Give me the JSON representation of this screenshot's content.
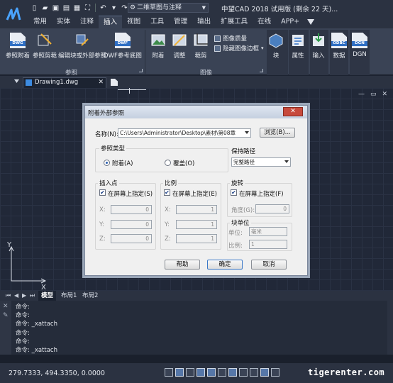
{
  "title_bar": {
    "workspace": "二维草图与注释",
    "app_title": "中望CAD 2018 试用版 (剩余 22 天)..."
  },
  "menu": {
    "tabs": [
      "常用",
      "实体",
      "注释",
      "插入",
      "视图",
      "工具",
      "管理",
      "输出",
      "扩展工具",
      "在线",
      "APP+"
    ],
    "active": "插入"
  },
  "ribbon": {
    "reference_panel": {
      "title": "参照",
      "buttons": [
        {
          "label": "参照附着",
          "badge": "DWG"
        },
        {
          "label": "参照剪裁",
          "badge": ""
        },
        {
          "label": "编辑块或外部参照",
          "badge": ""
        },
        {
          "label": "DWF参考底图",
          "badge": "DWF"
        }
      ]
    },
    "image_panel": {
      "title": "图像",
      "buttons": [
        "附着",
        "调整",
        "裁剪"
      ],
      "small_buttons": [
        "图像质量",
        "隐藏图像边框"
      ]
    },
    "right_buttons": [
      {
        "label": "块",
        "badge": ""
      },
      {
        "label": "属性",
        "badge": ""
      },
      {
        "label": "输入",
        "badge": ""
      },
      {
        "label": "数据",
        "badge": "ODBC"
      },
      {
        "label": "DGN",
        "badge": "DGN"
      }
    ]
  },
  "doc_tab": {
    "name": "Drawing1.dwg",
    "close": "✕"
  },
  "canvas": {
    "ucs_y": "Y",
    "ucs_x": "X",
    "win_min": "—",
    "win_max": "▭",
    "win_close": "✕"
  },
  "dialog": {
    "title": "附着外部参照",
    "close": "✕",
    "name_label": "名称(N):",
    "name_value": "C:\\Users\\Administrator\\Desktop\\素材\\第08章",
    "browse_label": "浏览(B)...",
    "ref_type": {
      "title": "参照类型",
      "options": [
        "附着(A)",
        "覆盖(O)"
      ],
      "selected": "附着(A)"
    },
    "path_type": {
      "title": "保持路径",
      "value": "完整路径"
    },
    "insert_point": {
      "title": "插入点",
      "on_screen": "在屏幕上指定(S)",
      "fields": [
        {
          "label": "X:",
          "value": "0"
        },
        {
          "label": "Y:",
          "value": "0"
        },
        {
          "label": "Z:",
          "value": "0"
        }
      ]
    },
    "scale": {
      "title": "比例",
      "on_screen": "在屏幕上指定(E)",
      "fields": [
        {
          "label": "X:",
          "value": "1"
        },
        {
          "label": "Y:",
          "value": "1"
        },
        {
          "label": "Z:",
          "value": "1"
        }
      ]
    },
    "rotation": {
      "title": "旋转",
      "on_screen": "在屏幕上指定(F)",
      "angle_label": "角度(G):",
      "angle_value": "0"
    },
    "block_unit": {
      "title": "块单位",
      "unit_label": "单位:",
      "unit_value": "毫米",
      "scale_label": "比例:",
      "scale_value": "1"
    },
    "buttons": {
      "help": "帮助",
      "ok": "确定",
      "cancel": "取消"
    }
  },
  "layout_tabs": {
    "nav": [
      "⏮",
      "◀",
      "▶",
      "⏭"
    ],
    "tabs": [
      "模型",
      "布局1",
      "布局2"
    ],
    "active": "模型"
  },
  "command_lines": [
    "命令:",
    "命令:",
    "命令: _xattach",
    "命令:",
    "命令:",
    "命令: _xattach"
  ],
  "command_gutter": [
    "✕",
    "✎"
  ],
  "status": {
    "coordinates": "279.7333, 494.3350, 0.0000"
  },
  "watermark": "tigerenter.com"
}
